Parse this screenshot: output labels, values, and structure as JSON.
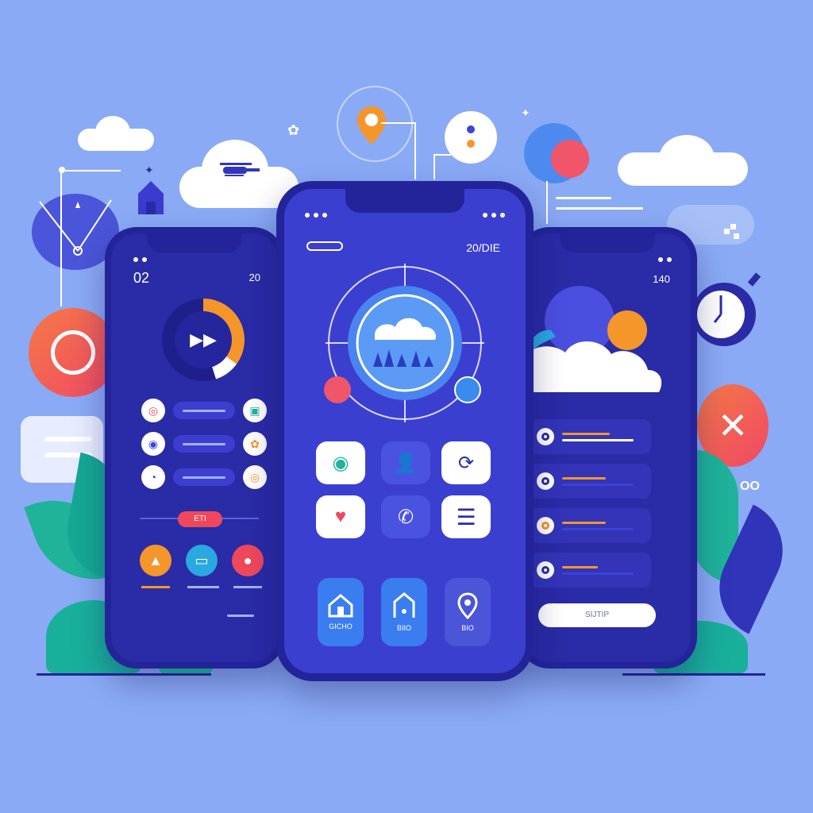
{
  "colors": {
    "background": "#8aaaf5",
    "phone": "#2a2ba6",
    "accent_orange": "#f5962a",
    "accent_red": "#f0485a",
    "accent_teal": "#1fb39a"
  },
  "left_phone": {
    "corner_left": "02",
    "corner_right": "20",
    "media_icon": "play-forward-icon",
    "button_label": "ЕТІ",
    "rows": [
      {
        "left_icon": "app-red-icon",
        "right_icon": "app-teal-icon"
      },
      {
        "left_icon": "app-blue-icon",
        "right_icon": "app-orange-icon"
      },
      {
        "left_icon": "app-blue-icon",
        "right_icon": "app-orange-icon"
      }
    ],
    "bottom_icons": [
      "warning-icon",
      "image-icon",
      "badge-icon"
    ]
  },
  "center_phone": {
    "header_right": "20/DIE",
    "hero_icon": "cloud-forest-icon",
    "tiles": [
      {
        "icon": "circle-icon",
        "style": "white"
      },
      {
        "icon": "user-icon",
        "style": "blue"
      },
      {
        "icon": "sync-icon",
        "style": "white"
      },
      {
        "icon": "heart-icon",
        "style": "white"
      },
      {
        "icon": "chat-icon",
        "style": "blue"
      },
      {
        "icon": "menu-icon",
        "style": "white"
      }
    ],
    "dock": [
      {
        "icon": "home-icon",
        "label": "GICHO"
      },
      {
        "icon": "house-icon",
        "label": "BIIO"
      },
      {
        "icon": "location-pin-icon",
        "label": "BIO"
      }
    ]
  },
  "right_phone": {
    "corner_right": "140",
    "hero_icon": "weather-sun-cloud-icon",
    "list_count": 4,
    "button_label": "SIJTIP"
  },
  "decorations": {
    "bottom_right_text": "OO"
  }
}
